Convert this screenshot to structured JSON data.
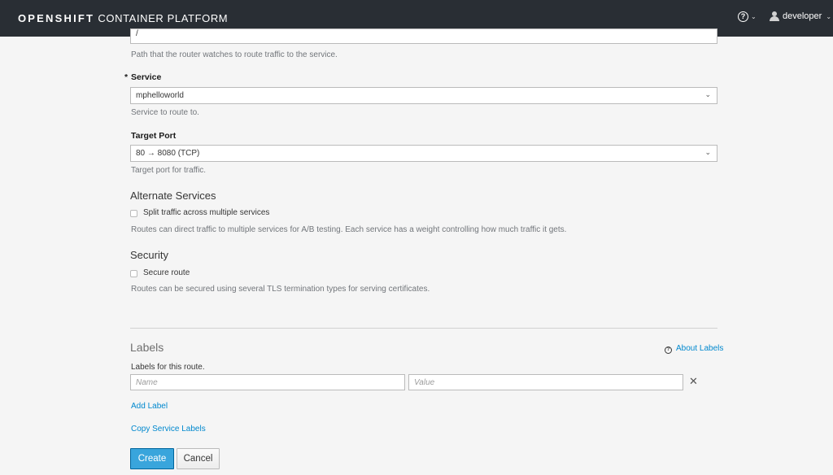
{
  "topbar": {
    "brand_bold": "OPENSHIFT",
    "brand_rest": " CONTAINER PLATFORM",
    "help_glyph": "?",
    "username": "developer"
  },
  "path": {
    "value": "/",
    "help": "Path that the router watches to route traffic to the service."
  },
  "service": {
    "required_marker": "*",
    "label": "Service",
    "selected": "mphelloworld",
    "help": "Service to route to."
  },
  "target_port": {
    "label": "Target Port",
    "selected": "80 → 8080 (TCP)",
    "help": "Target port for traffic."
  },
  "alternate_services": {
    "title": "Alternate Services",
    "checkbox_label": "Split traffic across multiple services",
    "checked": false,
    "help": "Routes can direct traffic to multiple services for A/B testing. Each service has a weight controlling how much traffic it gets."
  },
  "security": {
    "title": "Security",
    "checkbox_label": "Secure route",
    "checked": false,
    "help": "Routes can be secured using several TLS termination types for serving certificates."
  },
  "labels": {
    "title": "Labels",
    "about_link": "About Labels",
    "help": "Labels for this route.",
    "name_placeholder": "Name",
    "value_placeholder": "Value",
    "remove_glyph": "✕",
    "add_label": "Add Label",
    "copy_service_labels": "Copy Service Labels"
  },
  "actions": {
    "create": "Create",
    "cancel": "Cancel"
  },
  "icons": {
    "help": "help-circle-icon",
    "user": "user-icon",
    "chevron": "chevron-down-icon",
    "remove": "close-icon"
  },
  "colors": {
    "masthead": "#292e34",
    "primary": "#39a5dc",
    "link": "#0088ce",
    "background": "#f5f5f5"
  }
}
